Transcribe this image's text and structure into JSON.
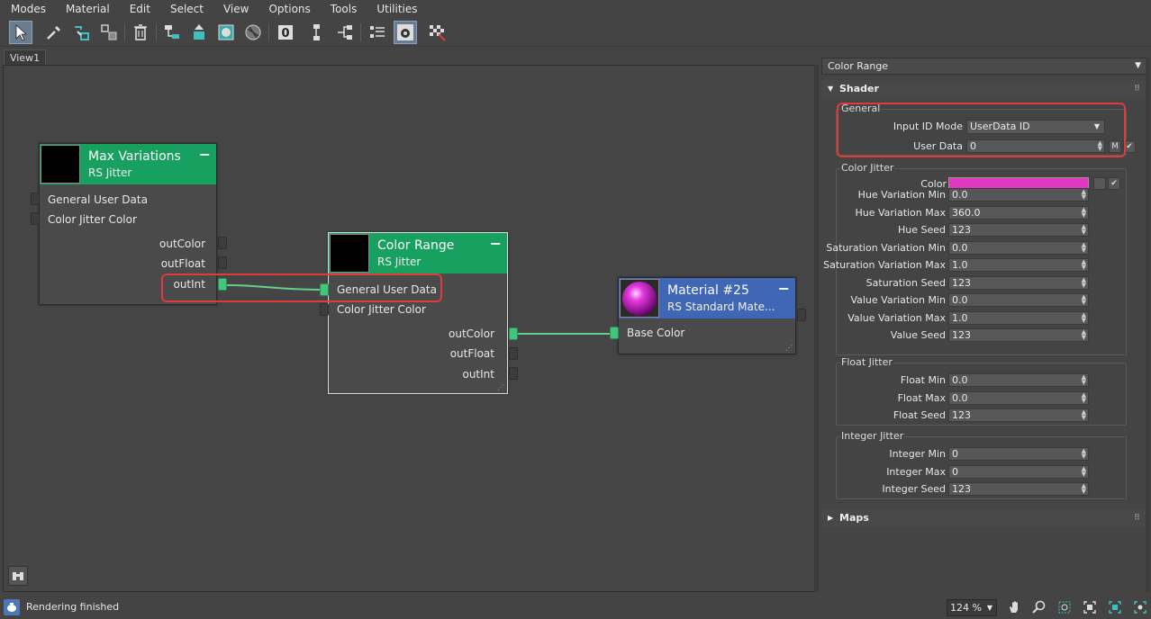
{
  "menu": [
    "Modes",
    "Material",
    "Edit",
    "Select",
    "View",
    "Options",
    "Tools",
    "Utilities"
  ],
  "toolbar": {
    "icons": [
      "select-arrow-icon",
      "eyedropper-icon",
      "pick-material-icon",
      "put-to-library-icon",
      "delete-icon",
      "move-children-icon",
      "put-to-scene-icon",
      "show-map-icon",
      "checker-background-icon",
      "material-id-channel-icon",
      "layout-all-icon",
      "layout-children-icon",
      "hide-unused-icon",
      "toggle-navigator-icon",
      "show-background-icon"
    ],
    "material_id_label": "0"
  },
  "view_tab": "View1",
  "nodes": {
    "max_variations": {
      "title": "Max Variations",
      "subtitle": "RS Jitter",
      "inputs": [
        "General User Data",
        "Color Jitter Color"
      ],
      "outputs": [
        "outColor",
        "outFloat",
        "outInt"
      ]
    },
    "color_range": {
      "title": "Color Range",
      "subtitle": "RS Jitter",
      "inputs": [
        "General User Data",
        "Color Jitter Color"
      ],
      "outputs": [
        "outColor",
        "outFloat",
        "outInt"
      ]
    },
    "material": {
      "title": "Material #25",
      "subtitle": "RS Standard Mate...",
      "inputs": [
        "Base Color"
      ]
    }
  },
  "colors": {
    "jitter_header": "#17a060",
    "material_header": "#3f67b5",
    "wire": "#62d089",
    "highlight": "#e03a3a",
    "swatch": "#e038c0"
  },
  "panel": {
    "title": "Color Range",
    "shader_rollout": "Shader",
    "maps_rollout": "Maps",
    "general": {
      "title": "General",
      "input_id_mode_label": "Input ID Mode",
      "input_id_mode_value": "UserData ID",
      "user_data_label": "User Data",
      "user_data_value": "0",
      "m_button": "M"
    },
    "color_jitter": {
      "title": "Color Jitter",
      "color_label": "Color",
      "rows": [
        {
          "label": "Hue Variation Min",
          "value": "0.0"
        },
        {
          "label": "Hue Variation Max",
          "value": "360.0"
        },
        {
          "label": "Hue Seed",
          "value": "123"
        },
        {
          "label": "Saturation Variation Min",
          "value": "0.0"
        },
        {
          "label": "Saturation Variation Max",
          "value": "1.0"
        },
        {
          "label": "Saturation Seed",
          "value": "123"
        },
        {
          "label": "Value Variation Min",
          "value": "0.0"
        },
        {
          "label": "Value Variation Max",
          "value": "1.0"
        },
        {
          "label": "Value Seed",
          "value": "123"
        }
      ]
    },
    "float_jitter": {
      "title": "Float Jitter",
      "rows": [
        {
          "label": "Float Min",
          "value": "0.0"
        },
        {
          "label": "Float Max",
          "value": "0.0"
        },
        {
          "label": "Float Seed",
          "value": "123"
        }
      ]
    },
    "integer_jitter": {
      "title": "Integer Jitter",
      "rows": [
        {
          "label": "Integer Min",
          "value": "0"
        },
        {
          "label": "Integer Max",
          "value": "0"
        },
        {
          "label": "Integer Seed",
          "value": "123"
        }
      ]
    }
  },
  "status": {
    "text": "Rendering finished",
    "zoom": "124 %"
  }
}
